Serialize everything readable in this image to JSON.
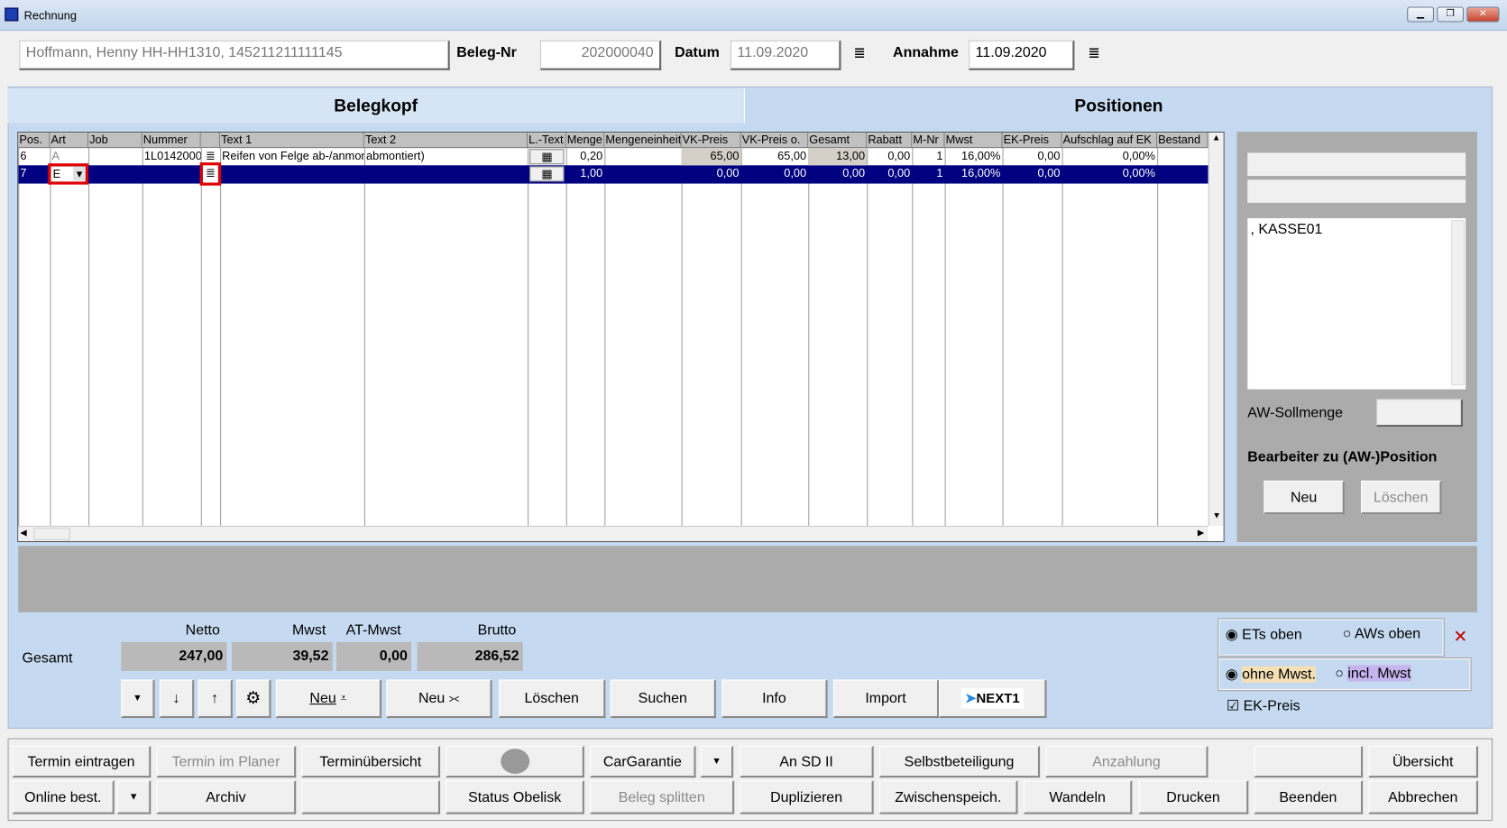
{
  "window": {
    "title": "Rechnung",
    "minimize": "▁",
    "restore": "❐",
    "close": "✕"
  },
  "header": {
    "customer": "Hoffmann, Henny HH-HH1310, 145211211111145",
    "beleg_nr_label": "Beleg-Nr",
    "beleg_nr": "202000040",
    "datum_label": "Datum",
    "datum": "11.09.2020",
    "annahme_label": "Annahme",
    "annahme": "11.09.2020",
    "list_icon": "≣"
  },
  "tabs": [
    {
      "label": "Belegkopf"
    },
    {
      "label": "Positionen"
    }
  ],
  "grid": {
    "columns": [
      "Pos.",
      "Art",
      "Job",
      "Nummer",
      "",
      "Text 1",
      "Text 2",
      "L.-Text",
      "Menge",
      "Mengeneinheit",
      "VK-Preis",
      "VK-Preis o.",
      "Gesamt",
      "Rabatt",
      "M-Nr",
      "Mwst",
      "EK-Preis",
      "Aufschlag auf EK",
      "Bestand"
    ],
    "rows": [
      {
        "pos": "6",
        "art": "A",
        "job": "",
        "nummer": "1L0142000",
        "text1": "Reifen von Felge ab-/anmon",
        "text2": "abmontiert)",
        "menge": "0,20",
        "einheit": "",
        "vk": "65,00",
        "vko": "65,00",
        "gesamt": "13,00",
        "rabatt": "0,00",
        "mnr": "1",
        "mwst": "16,00%",
        "ek": "0,00",
        "aufschlag": "0,00%",
        "bestand": ""
      },
      {
        "pos": "7",
        "art": "E",
        "job": "",
        "nummer": "",
        "text1": "",
        "text2": "",
        "menge": "1,00",
        "einheit": "",
        "vk": "0,00",
        "vko": "0,00",
        "gesamt": "0,00",
        "rabatt": "0,00",
        "mnr": "1",
        "mwst": "16,00%",
        "ek": "0,00",
        "aufschlag": "0,00%",
        "bestand": ""
      }
    ]
  },
  "side": {
    "textarea": ", KASSE01",
    "aw_soll_label": "AW-Sollmenge",
    "bearbeiter_label": "Bearbeiter zu (AW-)Position",
    "neu": "Neu",
    "loeschen": "Löschen"
  },
  "totals": {
    "row_label": "Gesamt",
    "netto_label": "Netto",
    "mwst_label": "Mwst",
    "atmwst_label": "AT-Mwst",
    "brutto_label": "Brutto",
    "netto": "247,00",
    "mwst": "39,52",
    "atmwst": "0,00",
    "brutto": "286,52"
  },
  "actions": {
    "neu1": "Neu",
    "neu2": "Neu",
    "loeschen": "Löschen",
    "suchen": "Suchen",
    "info": "Info",
    "import": "Import",
    "next": "NEXT1"
  },
  "options": {
    "ets_oben": "ETs oben",
    "aws_oben": "AWs oben",
    "ohne_mwst": "ohne Mwst.",
    "incl_mwst": "incl. Mwst",
    "ek_preis": "EK-Preis",
    "ets_selected": true,
    "ohne_selected": true,
    "ek_checked": true
  },
  "bottom": {
    "row1": [
      "Termin eintragen",
      "Termin im Planer",
      "Terminübersicht",
      "",
      "CarGarantie",
      "",
      "An SD II",
      "Selbstbeteiligung",
      "Anzahlung",
      "",
      "Übersicht"
    ],
    "row2": [
      "Online best.",
      "",
      "Archiv",
      "",
      "Status Obelisk",
      "Beleg splitten",
      "Duplizieren",
      "Zwischenspeich.",
      "Wandeln",
      "Drucken",
      "Beenden",
      "Abbrechen"
    ]
  }
}
